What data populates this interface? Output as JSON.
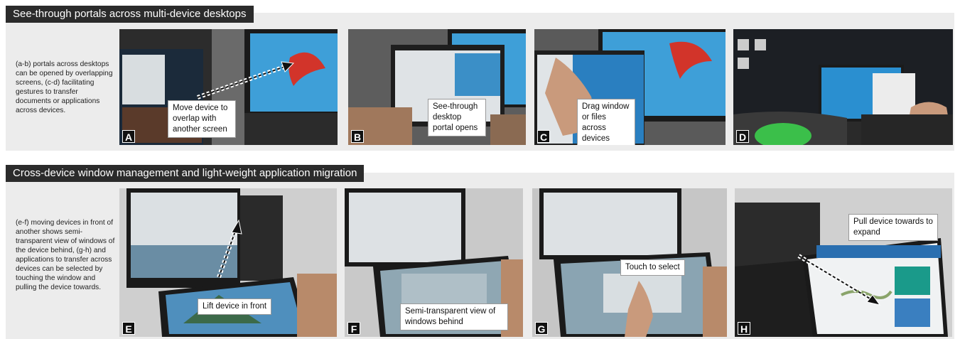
{
  "section_1": {
    "title": "See-through portals across multi-device desktops",
    "description": "(a-b) portals across desktops can be opened by overlapping screens, (c-d) facilitating gestures to transfer documents or applications across devices.",
    "panels": [
      {
        "label": "A",
        "callout": "Move device to overlap with another screen"
      },
      {
        "label": "B",
        "callout": "See-through desktop portal opens"
      },
      {
        "label": "C",
        "callout": "Drag window or files across devices"
      },
      {
        "label": "D",
        "callout": ""
      }
    ]
  },
  "section_2": {
    "title": "Cross-device window management and light-weight application migration",
    "description": "(e-f) moving devices in front of another shows semi-transparent view of windows of the device behind, (g-h) and applications to transfer across devices can be selected by touching the window and pulling the device towards.",
    "panels": [
      {
        "label": "E",
        "callout": "Lift device in front"
      },
      {
        "label": "F",
        "callout": "Semi-transparent view of windows behind"
      },
      {
        "label": "G",
        "callout": "Touch to select"
      },
      {
        "label": "H",
        "callout": "Pull device towards to expand"
      }
    ]
  },
  "colors": {
    "header_bg": "#2b2b2b",
    "section_bg": "#ececec",
    "desktop_blue": "#2a8fd0",
    "flower_red": "#d2342a"
  }
}
